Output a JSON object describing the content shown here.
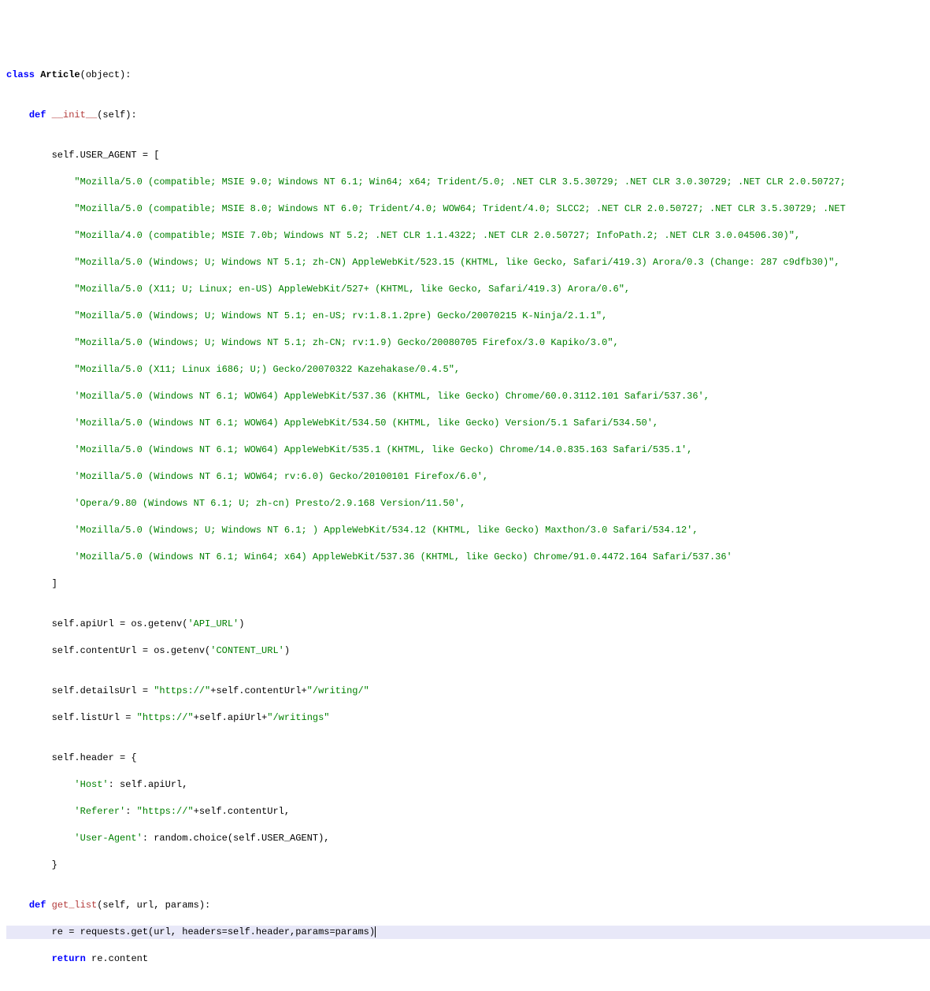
{
  "code": {
    "l1_kw_class": "class",
    "l1_cls": " Article",
    "l1_paren": "(",
    "l1_obj": "object",
    "l1_close": "):",
    "blank1": "",
    "l2_indent": "    ",
    "l2_kw_def": "def",
    "l2_fn": " __init__",
    "l2_sig": "(self):",
    "blank2": "",
    "l3": "        self.USER_AGENT = [",
    "ua0": "            \"Mozilla/5.0 (compatible; MSIE 9.0; Windows NT 6.1; Win64; x64; Trident/5.0; .NET CLR 3.5.30729; .NET CLR 3.0.30729; .NET CLR 2.0.50727;",
    "ua1": "            \"Mozilla/5.0 (compatible; MSIE 8.0; Windows NT 6.0; Trident/4.0; WOW64; Trident/4.0; SLCC2; .NET CLR 2.0.50727; .NET CLR 3.5.30729; .NET",
    "ua2": "            \"Mozilla/4.0 (compatible; MSIE 7.0b; Windows NT 5.2; .NET CLR 1.1.4322; .NET CLR 2.0.50727; InfoPath.2; .NET CLR 3.0.04506.30)\",",
    "ua3": "            \"Mozilla/5.0 (Windows; U; Windows NT 5.1; zh-CN) AppleWebKit/523.15 (KHTML, like Gecko, Safari/419.3) Arora/0.3 (Change: 287 c9dfb30)\",",
    "ua4": "            \"Mozilla/5.0 (X11; U; Linux; en-US) AppleWebKit/527+ (KHTML, like Gecko, Safari/419.3) Arora/0.6\",",
    "ua5": "            \"Mozilla/5.0 (Windows; U; Windows NT 5.1; en-US; rv:1.8.1.2pre) Gecko/20070215 K-Ninja/2.1.1\",",
    "ua6": "            \"Mozilla/5.0 (Windows; U; Windows NT 5.1; zh-CN; rv:1.9) Gecko/20080705 Firefox/3.0 Kapiko/3.0\",",
    "ua7": "            \"Mozilla/5.0 (X11; Linux i686; U;) Gecko/20070322 Kazehakase/0.4.5\",",
    "ua8": "            'Mozilla/5.0 (Windows NT 6.1; WOW64) AppleWebKit/537.36 (KHTML, like Gecko) Chrome/60.0.3112.101 Safari/537.36',",
    "ua9": "            'Mozilla/5.0 (Windows NT 6.1; WOW64) AppleWebKit/534.50 (KHTML, like Gecko) Version/5.1 Safari/534.50',",
    "ua10": "            'Mozilla/5.0 (Windows NT 6.1; WOW64) AppleWebKit/535.1 (KHTML, like Gecko) Chrome/14.0.835.163 Safari/535.1',",
    "ua11": "            'Mozilla/5.0 (Windows NT 6.1; WOW64; rv:6.0) Gecko/20100101 Firefox/6.0',",
    "ua12": "            'Opera/9.80 (Windows NT 6.1; U; zh-cn) Presto/2.9.168 Version/11.50',",
    "ua13": "            'Mozilla/5.0 (Windows; U; Windows NT 6.1; ) AppleWebKit/534.12 (KHTML, like Gecko) Maxthon/3.0 Safari/534.12',",
    "ua14": "            'Mozilla/5.0 (Windows NT 6.1; Win64; x64) AppleWebKit/537.36 (KHTML, like Gecko) Chrome/91.0.4472.164 Safari/537.36'",
    "l_close_bracket": "        ]",
    "blank3": "",
    "api_pre": "        self.apiUrl = os.getenv(",
    "api_str": "'API_URL'",
    "api_post": ")",
    "content_pre": "        self.contentUrl = os.getenv(",
    "content_str": "'CONTENT_URL'",
    "content_post": ")",
    "blank4": "",
    "details_pre": "        self.detailsUrl = ",
    "details_s1": "\"https://\"",
    "details_mid": "+self.contentUrl+",
    "details_s2": "\"/writing/\"",
    "list_pre": "        self.listUrl = ",
    "list_s1": "\"https://\"",
    "list_mid": "+self.apiUrl+",
    "list_s2": "\"/writings\"",
    "blank5": "",
    "header_open": "        self.header = {",
    "host_k": "            'Host'",
    "host_v": ": self.apiUrl,",
    "ref_k": "            'Referer'",
    "ref_colon": ": ",
    "ref_s": "\"https://\"",
    "ref_post": "+self.contentUrl,",
    "uak_k": "            'User-Agent'",
    "uak_v": ": random.choice(self.USER_AGENT),",
    "header_close": "        }",
    "blank6": "",
    "gl_indent": "    ",
    "gl_kw_def": "def",
    "gl_fn": " get_list",
    "gl_sig": "(self, url, params):",
    "re_line": "        re = requests.get(url, headers=self.header,params=params)",
    "ret_indent": "        ",
    "ret_kw": "return",
    "ret_rest": " re.content"
  },
  "cursor": {
    "line": "re_line",
    "position": 62
  }
}
